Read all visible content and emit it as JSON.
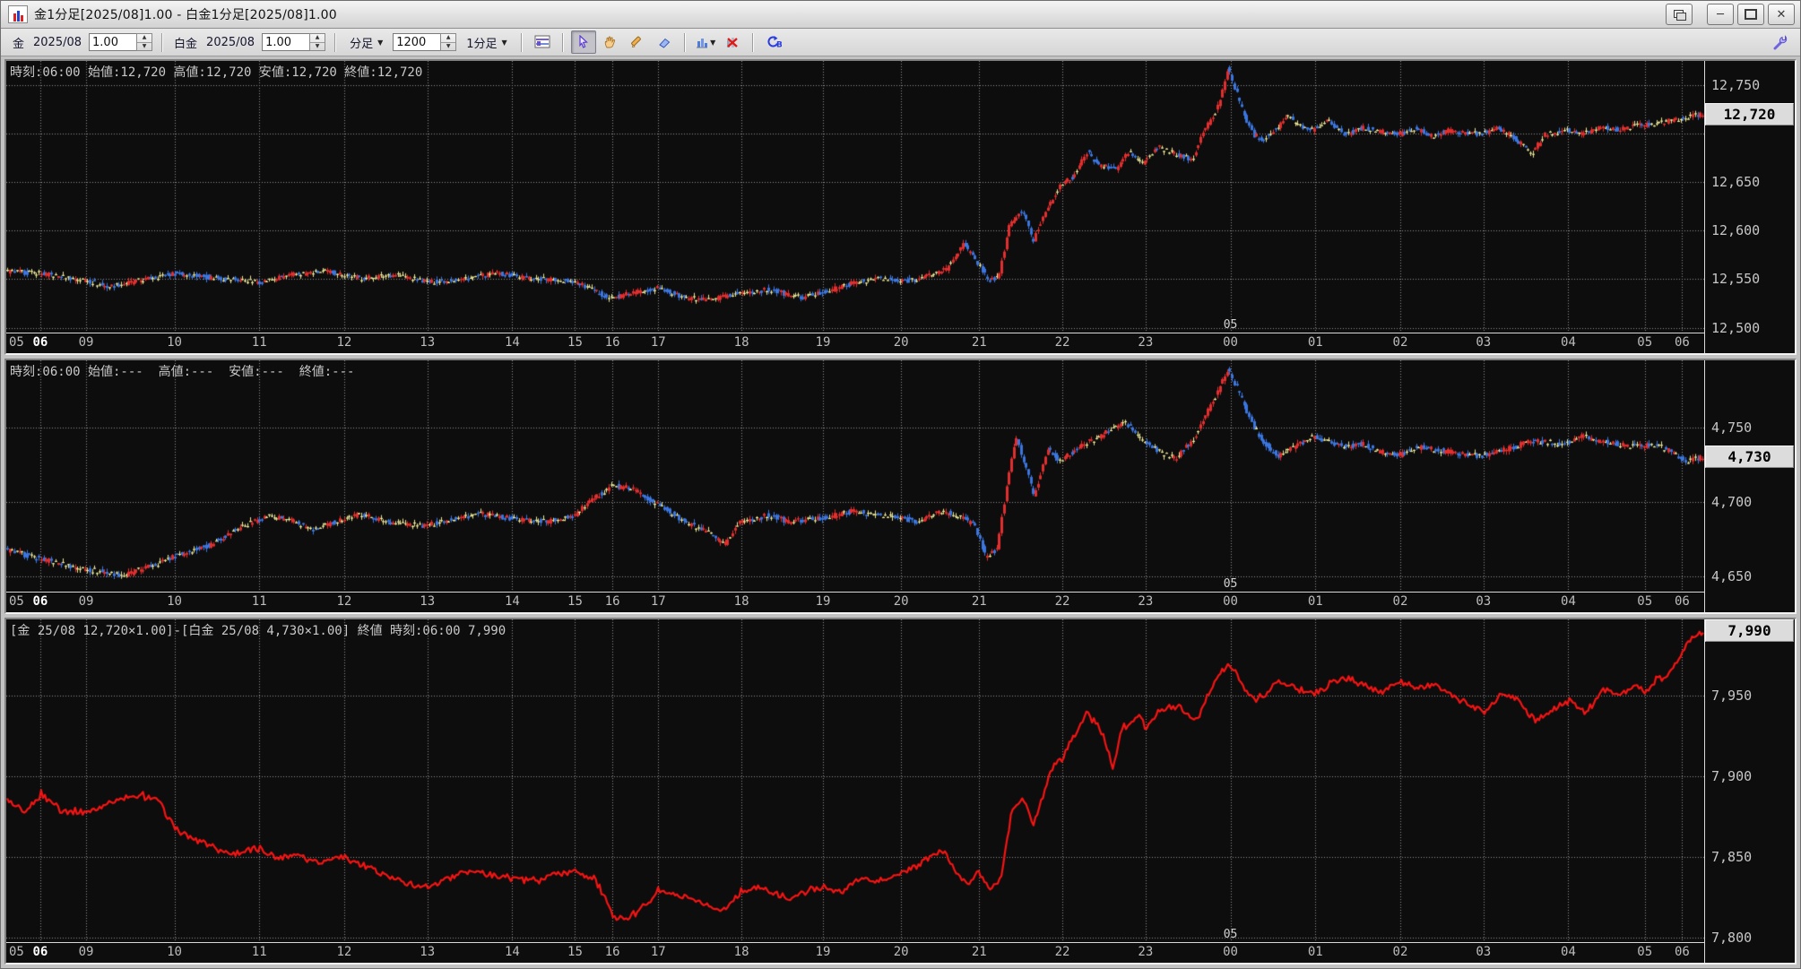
{
  "window": {
    "title": "金1分足[2025/08]1.00 - 白金1分足[2025/08]1.00",
    "controls": [
      "cascade",
      "minimize",
      "maximize",
      "close"
    ]
  },
  "toolbar": {
    "gold_label": "金",
    "gold_month": "2025/08",
    "gold_multiplier": "1.00",
    "platinum_label": "白金",
    "platinum_month": "2025/08",
    "platinum_multiplier": "1.00",
    "interval_type_label": "分足",
    "bar_count": "1200",
    "period_label": "1分足",
    "icons": [
      "chart-grid",
      "cursor",
      "hand",
      "pencil",
      "eraser",
      "bar-chart",
      "delete-indicator",
      "refresh-cb",
      "wrench"
    ]
  },
  "colors": {
    "up": "#e22e2e",
    "down": "#3b76e0",
    "doji": "#e8e494",
    "spread_line": "#f51414",
    "grid": "#8f8f8f",
    "chart_bg": "#0d0d0d",
    "axis_text": "#c6c6c6",
    "badge_bg": "#dcdcdc"
  },
  "xaxis": {
    "labels": [
      {
        "text": "05",
        "f": 0.004
      },
      {
        "text": "06",
        "f": 0.02
      },
      {
        "text": "09",
        "f": 0.047
      },
      {
        "text": "10",
        "f": 0.099
      },
      {
        "text": "11",
        "f": 0.149
      },
      {
        "text": "12",
        "f": 0.199
      },
      {
        "text": "13",
        "f": 0.248
      },
      {
        "text": "14",
        "f": 0.298
      },
      {
        "text": "15",
        "f": 0.335
      },
      {
        "text": "16",
        "f": 0.357
      },
      {
        "text": "17",
        "f": 0.384
      },
      {
        "text": "18",
        "f": 0.433
      },
      {
        "text": "19",
        "f": 0.481
      },
      {
        "text": "20",
        "f": 0.527
      },
      {
        "text": "21",
        "f": 0.573
      },
      {
        "text": "22",
        "f": 0.622
      },
      {
        "text": "23",
        "f": 0.671
      },
      {
        "text": "00",
        "f": 0.721
      },
      {
        "text": "01",
        "f": 0.771
      },
      {
        "text": "02",
        "f": 0.821
      },
      {
        "text": "03",
        "f": 0.87
      },
      {
        "text": "04",
        "f": 0.92
      },
      {
        "text": "05",
        "f": 0.965
      },
      {
        "text": "06",
        "f": 0.987
      }
    ],
    "highlight_index": 1
  },
  "charts": [
    {
      "name": "gold-1min",
      "header": "時刻:06:00 始値:12,720 高値:12,720 安値:12,720 終値:12,720",
      "type": "candle",
      "flex": 333,
      "ylim": [
        12495,
        12775
      ],
      "grid": [
        12500,
        12550,
        12600,
        12650,
        12700,
        12750
      ],
      "tick_labels": [
        {
          "text": "12,750",
          "v": 12750
        },
        {
          "text": "12,650",
          "v": 12650
        },
        {
          "text": "12,600",
          "v": 12600
        },
        {
          "text": "12,550",
          "v": 12550
        },
        {
          "text": "12,500",
          "v": 12500
        }
      ],
      "badge": {
        "text": "12,720",
        "v": 12720
      },
      "date_label": {
        "text": "05",
        "f": 0.721
      },
      "noise": 5,
      "bars": 700,
      "anchors": [
        [
          0,
          12558
        ],
        [
          0.02,
          12556
        ],
        [
          0.047,
          12549
        ],
        [
          0.06,
          12542
        ],
        [
          0.08,
          12549
        ],
        [
          0.1,
          12556
        ],
        [
          0.12,
          12552
        ],
        [
          0.15,
          12547
        ],
        [
          0.17,
          12555
        ],
        [
          0.19,
          12558
        ],
        [
          0.21,
          12551
        ],
        [
          0.23,
          12555
        ],
        [
          0.25,
          12547
        ],
        [
          0.27,
          12550
        ],
        [
          0.29,
          12556
        ],
        [
          0.31,
          12551
        ],
        [
          0.335,
          12548
        ],
        [
          0.357,
          12530
        ],
        [
          0.37,
          12536
        ],
        [
          0.384,
          12541
        ],
        [
          0.4,
          12531
        ],
        [
          0.415,
          12528
        ],
        [
          0.433,
          12536
        ],
        [
          0.45,
          12539
        ],
        [
          0.47,
          12531
        ],
        [
          0.481,
          12536
        ],
        [
          0.5,
          12546
        ],
        [
          0.515,
          12551
        ],
        [
          0.527,
          12547
        ],
        [
          0.54,
          12551
        ],
        [
          0.555,
          12561
        ],
        [
          0.565,
          12586
        ],
        [
          0.573,
          12568
        ],
        [
          0.58,
          12549
        ],
        [
          0.586,
          12552
        ],
        [
          0.592,
          12606
        ],
        [
          0.6,
          12621
        ],
        [
          0.606,
          12589
        ],
        [
          0.615,
          12626
        ],
        [
          0.622,
          12646
        ],
        [
          0.63,
          12656
        ],
        [
          0.638,
          12681
        ],
        [
          0.645,
          12668
        ],
        [
          0.655,
          12663
        ],
        [
          0.662,
          12681
        ],
        [
          0.671,
          12670
        ],
        [
          0.68,
          12686
        ],
        [
          0.69,
          12679
        ],
        [
          0.7,
          12673
        ],
        [
          0.706,
          12701
        ],
        [
          0.712,
          12716
        ],
        [
          0.717,
          12737
        ],
        [
          0.721,
          12768
        ],
        [
          0.726,
          12743
        ],
        [
          0.731,
          12718
        ],
        [
          0.736,
          12699
        ],
        [
          0.742,
          12694
        ],
        [
          0.75,
          12706
        ],
        [
          0.756,
          12719
        ],
        [
          0.762,
          12709
        ],
        [
          0.771,
          12704
        ],
        [
          0.78,
          12714
        ],
        [
          0.79,
          12699
        ],
        [
          0.8,
          12706
        ],
        [
          0.821,
          12699
        ],
        [
          0.832,
          12706
        ],
        [
          0.84,
          12697
        ],
        [
          0.85,
          12703
        ],
        [
          0.87,
          12700
        ],
        [
          0.88,
          12706
        ],
        [
          0.89,
          12696
        ],
        [
          0.9,
          12679
        ],
        [
          0.908,
          12699
        ],
        [
          0.92,
          12704
        ],
        [
          0.93,
          12699
        ],
        [
          0.94,
          12707
        ],
        [
          0.95,
          12704
        ],
        [
          0.965,
          12709
        ],
        [
          0.975,
          12711
        ],
        [
          0.99,
          12716
        ],
        [
          1,
          12720
        ]
      ]
    },
    {
      "name": "platinum-1min",
      "header": "時刻:06:00 始値:---  高値:---  安値:---  終値:---",
      "type": "candle",
      "flex": 287,
      "ylim": [
        4640,
        4795
      ],
      "grid": [
        4650,
        4700,
        4750
      ],
      "tick_labels": [
        {
          "text": "4,750",
          "v": 4750
        },
        {
          "text": "4,700",
          "v": 4700
        },
        {
          "text": "4,650",
          "v": 4650
        }
      ],
      "badge": {
        "text": "4,730",
        "v": 4730
      },
      "date_label": {
        "text": "05",
        "f": 0.721
      },
      "noise": 3.5,
      "bars": 700,
      "anchors": [
        [
          0,
          4668
        ],
        [
          0.02,
          4662
        ],
        [
          0.047,
          4655
        ],
        [
          0.07,
          4651
        ],
        [
          0.09,
          4659
        ],
        [
          0.1,
          4664
        ],
        [
          0.12,
          4671
        ],
        [
          0.14,
          4684
        ],
        [
          0.155,
          4691
        ],
        [
          0.17,
          4687
        ],
        [
          0.182,
          4681
        ],
        [
          0.199,
          4689
        ],
        [
          0.21,
          4692
        ],
        [
          0.225,
          4687
        ],
        [
          0.248,
          4684
        ],
        [
          0.26,
          4688
        ],
        [
          0.28,
          4692
        ],
        [
          0.298,
          4689
        ],
        [
          0.32,
          4687
        ],
        [
          0.335,
          4691
        ],
        [
          0.357,
          4711
        ],
        [
          0.37,
          4709
        ],
        [
          0.384,
          4699
        ],
        [
          0.4,
          4687
        ],
        [
          0.415,
          4679
        ],
        [
          0.424,
          4671
        ],
        [
          0.433,
          4687
        ],
        [
          0.45,
          4691
        ],
        [
          0.462,
          4687
        ],
        [
          0.481,
          4689
        ],
        [
          0.5,
          4694
        ],
        [
          0.515,
          4691
        ],
        [
          0.527,
          4689
        ],
        [
          0.54,
          4687
        ],
        [
          0.55,
          4694
        ],
        [
          0.562,
          4691
        ],
        [
          0.572,
          4684
        ],
        [
          0.578,
          4664
        ],
        [
          0.585,
          4668
        ],
        [
          0.591,
          4714
        ],
        [
          0.596,
          4744
        ],
        [
          0.602,
          4722
        ],
        [
          0.607,
          4704
        ],
        [
          0.615,
          4737
        ],
        [
          0.622,
          4727
        ],
        [
          0.63,
          4734
        ],
        [
          0.64,
          4741
        ],
        [
          0.65,
          4747
        ],
        [
          0.66,
          4754
        ],
        [
          0.671,
          4741
        ],
        [
          0.68,
          4734
        ],
        [
          0.69,
          4729
        ],
        [
          0.7,
          4741
        ],
        [
          0.706,
          4754
        ],
        [
          0.713,
          4769
        ],
        [
          0.721,
          4789
        ],
        [
          0.728,
          4773
        ],
        [
          0.735,
          4753
        ],
        [
          0.743,
          4739
        ],
        [
          0.75,
          4731
        ],
        [
          0.76,
          4737
        ],
        [
          0.771,
          4744
        ],
        [
          0.78,
          4741
        ],
        [
          0.79,
          4737
        ],
        [
          0.8,
          4739
        ],
        [
          0.81,
          4734
        ],
        [
          0.821,
          4731
        ],
        [
          0.832,
          4737
        ],
        [
          0.85,
          4734
        ],
        [
          0.87,
          4731
        ],
        [
          0.88,
          4734
        ],
        [
          0.89,
          4737
        ],
        [
          0.9,
          4741
        ],
        [
          0.92,
          4739
        ],
        [
          0.93,
          4744
        ],
        [
          0.94,
          4741
        ],
        [
          0.95,
          4739
        ],
        [
          0.962,
          4737
        ],
        [
          0.972,
          4739
        ],
        [
          0.982,
          4734
        ],
        [
          0.992,
          4727
        ],
        [
          1,
          4730
        ]
      ]
    },
    {
      "name": "spread-gold-platinum",
      "header": "[金 25/08 12,720×1.00]-[白金 25/08 4,730×1.00] 終値 時刻:06:00 7,990",
      "type": "line",
      "flex": 391,
      "ylim": [
        7797,
        7997
      ],
      "grid": [
        7800,
        7850,
        7900,
        7950
      ],
      "tick_labels": [
        {
          "text": "7,950",
          "v": 7950
        },
        {
          "text": "7,900",
          "v": 7900
        },
        {
          "text": "7,850",
          "v": 7850
        },
        {
          "text": "7,800",
          "v": 7800
        }
      ],
      "badge": {
        "text": "7,990",
        "v": 7990
      },
      "date_label": {
        "text": "05",
        "f": 0.721
      },
      "noise": 3,
      "bars": 900,
      "anchors": [
        [
          0,
          7885
        ],
        [
          0.01,
          7877
        ],
        [
          0.02,
          7889
        ],
        [
          0.032,
          7879
        ],
        [
          0.047,
          7877
        ],
        [
          0.06,
          7884
        ],
        [
          0.08,
          7888
        ],
        [
          0.09,
          7884
        ],
        [
          0.099,
          7867
        ],
        [
          0.11,
          7861
        ],
        [
          0.12,
          7857
        ],
        [
          0.132,
          7851
        ],
        [
          0.149,
          7855
        ],
        [
          0.16,
          7849
        ],
        [
          0.17,
          7852
        ],
        [
          0.182,
          7847
        ],
        [
          0.199,
          7850
        ],
        [
          0.21,
          7844
        ],
        [
          0.222,
          7839
        ],
        [
          0.235,
          7834
        ],
        [
          0.248,
          7831
        ],
        [
          0.26,
          7837
        ],
        [
          0.272,
          7841
        ],
        [
          0.285,
          7839
        ],
        [
          0.298,
          7837
        ],
        [
          0.312,
          7835
        ],
        [
          0.322,
          7839
        ],
        [
          0.335,
          7841
        ],
        [
          0.346,
          7837
        ],
        [
          0.357,
          7814
        ],
        [
          0.366,
          7811
        ],
        [
          0.373,
          7817
        ],
        [
          0.384,
          7829
        ],
        [
          0.392,
          7827
        ],
        [
          0.402,
          7824
        ],
        [
          0.412,
          7819
        ],
        [
          0.423,
          7817
        ],
        [
          0.433,
          7829
        ],
        [
          0.442,
          7831
        ],
        [
          0.452,
          7827
        ],
        [
          0.462,
          7824
        ],
        [
          0.472,
          7829
        ],
        [
          0.481,
          7831
        ],
        [
          0.492,
          7827
        ],
        [
          0.502,
          7837
        ],
        [
          0.512,
          7834
        ],
        [
          0.527,
          7839
        ],
        [
          0.54,
          7847
        ],
        [
          0.551,
          7854
        ],
        [
          0.561,
          7839
        ],
        [
          0.567,
          7834
        ],
        [
          0.573,
          7841
        ],
        [
          0.579,
          7829
        ],
        [
          0.586,
          7837
        ],
        [
          0.592,
          7877
        ],
        [
          0.599,
          7887
        ],
        [
          0.605,
          7869
        ],
        [
          0.611,
          7889
        ],
        [
          0.616,
          7904
        ],
        [
          0.622,
          7911
        ],
        [
          0.63,
          7927
        ],
        [
          0.636,
          7939
        ],
        [
          0.642,
          7933
        ],
        [
          0.647,
          7923
        ],
        [
          0.652,
          7904
        ],
        [
          0.657,
          7929
        ],
        [
          0.663,
          7934
        ],
        [
          0.668,
          7939
        ],
        [
          0.671,
          7929
        ],
        [
          0.68,
          7941
        ],
        [
          0.69,
          7944
        ],
        [
          0.696,
          7939
        ],
        [
          0.701,
          7934
        ],
        [
          0.707,
          7949
        ],
        [
          0.713,
          7961
        ],
        [
          0.721,
          7969
        ],
        [
          0.73,
          7954
        ],
        [
          0.736,
          7947
        ],
        [
          0.742,
          7951
        ],
        [
          0.75,
          7959
        ],
        [
          0.76,
          7954
        ],
        [
          0.771,
          7951
        ],
        [
          0.78,
          7957
        ],
        [
          0.79,
          7961
        ],
        [
          0.8,
          7957
        ],
        [
          0.81,
          7951
        ],
        [
          0.821,
          7959
        ],
        [
          0.832,
          7954
        ],
        [
          0.841,
          7957
        ],
        [
          0.851,
          7951
        ],
        [
          0.861,
          7944
        ],
        [
          0.871,
          7939
        ],
        [
          0.881,
          7951
        ],
        [
          0.891,
          7947
        ],
        [
          0.901,
          7934
        ],
        [
          0.911,
          7941
        ],
        [
          0.921,
          7947
        ],
        [
          0.931,
          7939
        ],
        [
          0.941,
          7954
        ],
        [
          0.951,
          7951
        ],
        [
          0.961,
          7957
        ],
        [
          0.966,
          7951
        ],
        [
          0.972,
          7959
        ],
        [
          0.981,
          7964
        ],
        [
          0.986,
          7974
        ],
        [
          0.992,
          7984
        ],
        [
          1,
          7990
        ]
      ]
    }
  ]
}
